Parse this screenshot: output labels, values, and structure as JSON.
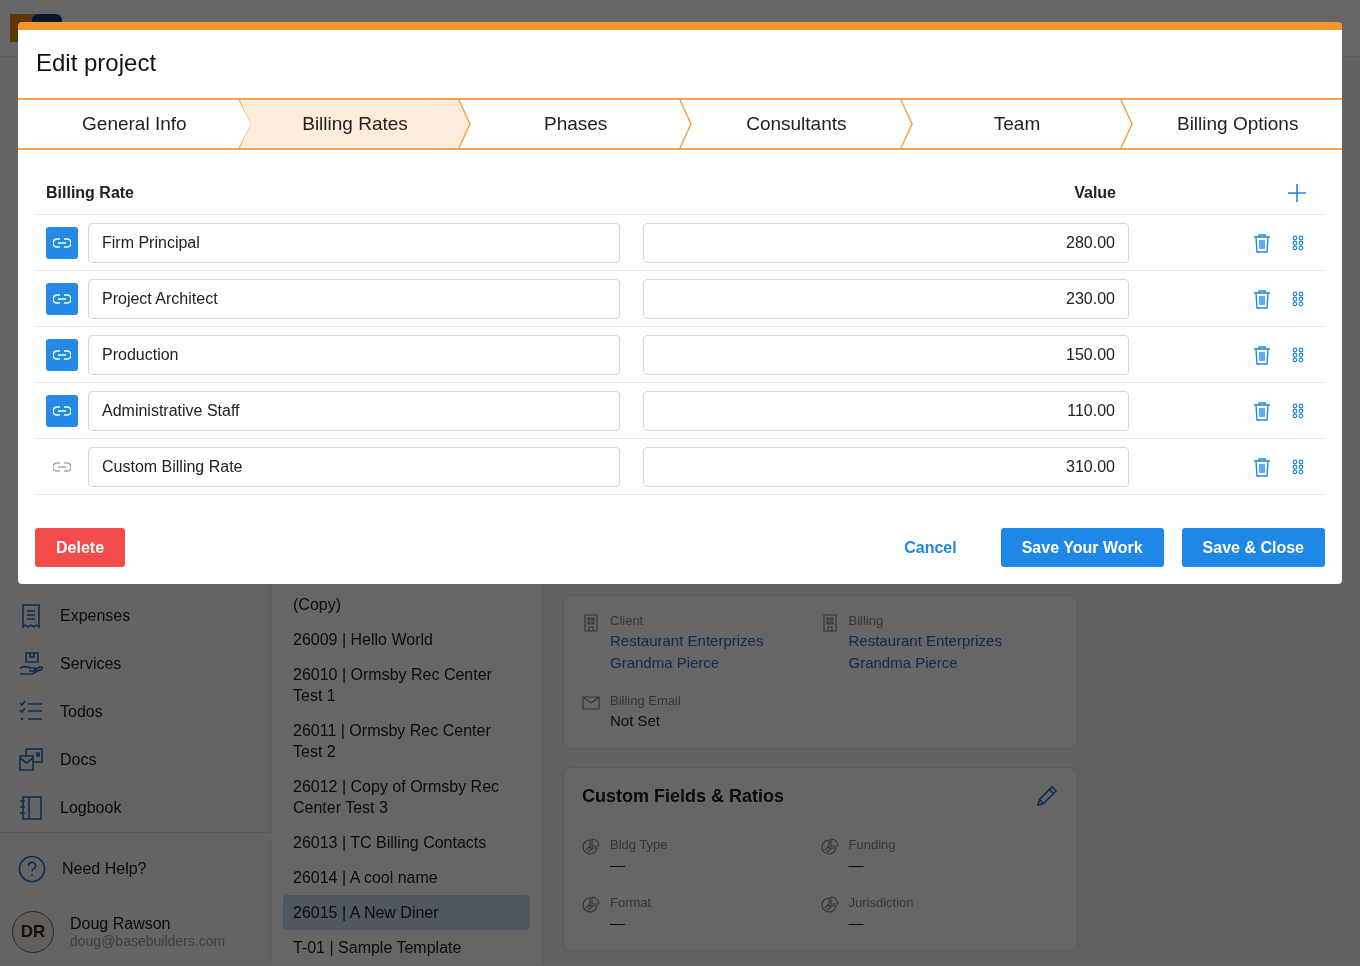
{
  "sidebar": {
    "items": [
      {
        "label": "Expenses"
      },
      {
        "label": "Services"
      },
      {
        "label": "Todos"
      },
      {
        "label": "Docs"
      },
      {
        "label": "Logbook"
      }
    ],
    "help": "Need Help?",
    "user": {
      "initials": "DR",
      "name": "Doug Rawson",
      "email": "doug@basebuilders.com"
    }
  },
  "projects": {
    "items": [
      {
        "label": "(Copy)",
        "selected": false
      },
      {
        "label": "26009 | Hello World",
        "selected": false
      },
      {
        "label": "26010 | Ormsby Rec Center Test 1",
        "selected": false
      },
      {
        "label": "26011 | Ormsby Rec Center Test 2",
        "selected": false
      },
      {
        "label": "26012 | Copy of Ormsby Rec Center Test 3",
        "selected": false
      },
      {
        "label": "26013 | TC Billing Contacts",
        "selected": false
      },
      {
        "label": "26014 | A cool name",
        "selected": false
      },
      {
        "label": "26015 | A New Diner",
        "selected": true
      },
      {
        "label": "T-01 | Sample Template",
        "selected": false
      }
    ]
  },
  "detail": {
    "contacts": [
      {
        "label": "Client",
        "lines": [
          "Restaurant Enterprizes",
          "Grandma Pierce"
        ]
      },
      {
        "label": "Billing",
        "lines": [
          "Restaurant Enterprizes",
          "Grandma Pierce"
        ]
      }
    ],
    "billing_email": {
      "label": "Billing Email",
      "value": "Not Set"
    },
    "custom_fields": {
      "title": "Custom Fields & Ratios",
      "fields": [
        {
          "label": "Bldg Type",
          "value": "—"
        },
        {
          "label": "Funding",
          "value": "—"
        },
        {
          "label": "Format",
          "value": "—"
        },
        {
          "label": "Jurisdiction",
          "value": "—"
        }
      ]
    }
  },
  "modal": {
    "title": "Edit project",
    "tabs": [
      {
        "label": "General Info",
        "selected": false
      },
      {
        "label": "Billing Rates",
        "selected": true
      },
      {
        "label": "Phases",
        "selected": false
      },
      {
        "label": "Consultants",
        "selected": false
      },
      {
        "label": "Team",
        "selected": false
      },
      {
        "label": "Billing Options",
        "selected": false
      }
    ],
    "columns": [
      "Billing Rate",
      "Value"
    ],
    "rates": [
      {
        "name": "Firm Principal",
        "value": "280.00",
        "linked": true
      },
      {
        "name": "Project Architect",
        "value": "230.00",
        "linked": true
      },
      {
        "name": "Production",
        "value": "150.00",
        "linked": true
      },
      {
        "name": "Administrative Staff",
        "value": "110.00",
        "linked": true
      },
      {
        "name": "Custom Billing Rate",
        "value": "310.00",
        "linked": false
      }
    ],
    "buttons": {
      "delete": "Delete",
      "cancel": "Cancel",
      "save": "Save Your Work",
      "save_close": "Save & Close"
    }
  }
}
